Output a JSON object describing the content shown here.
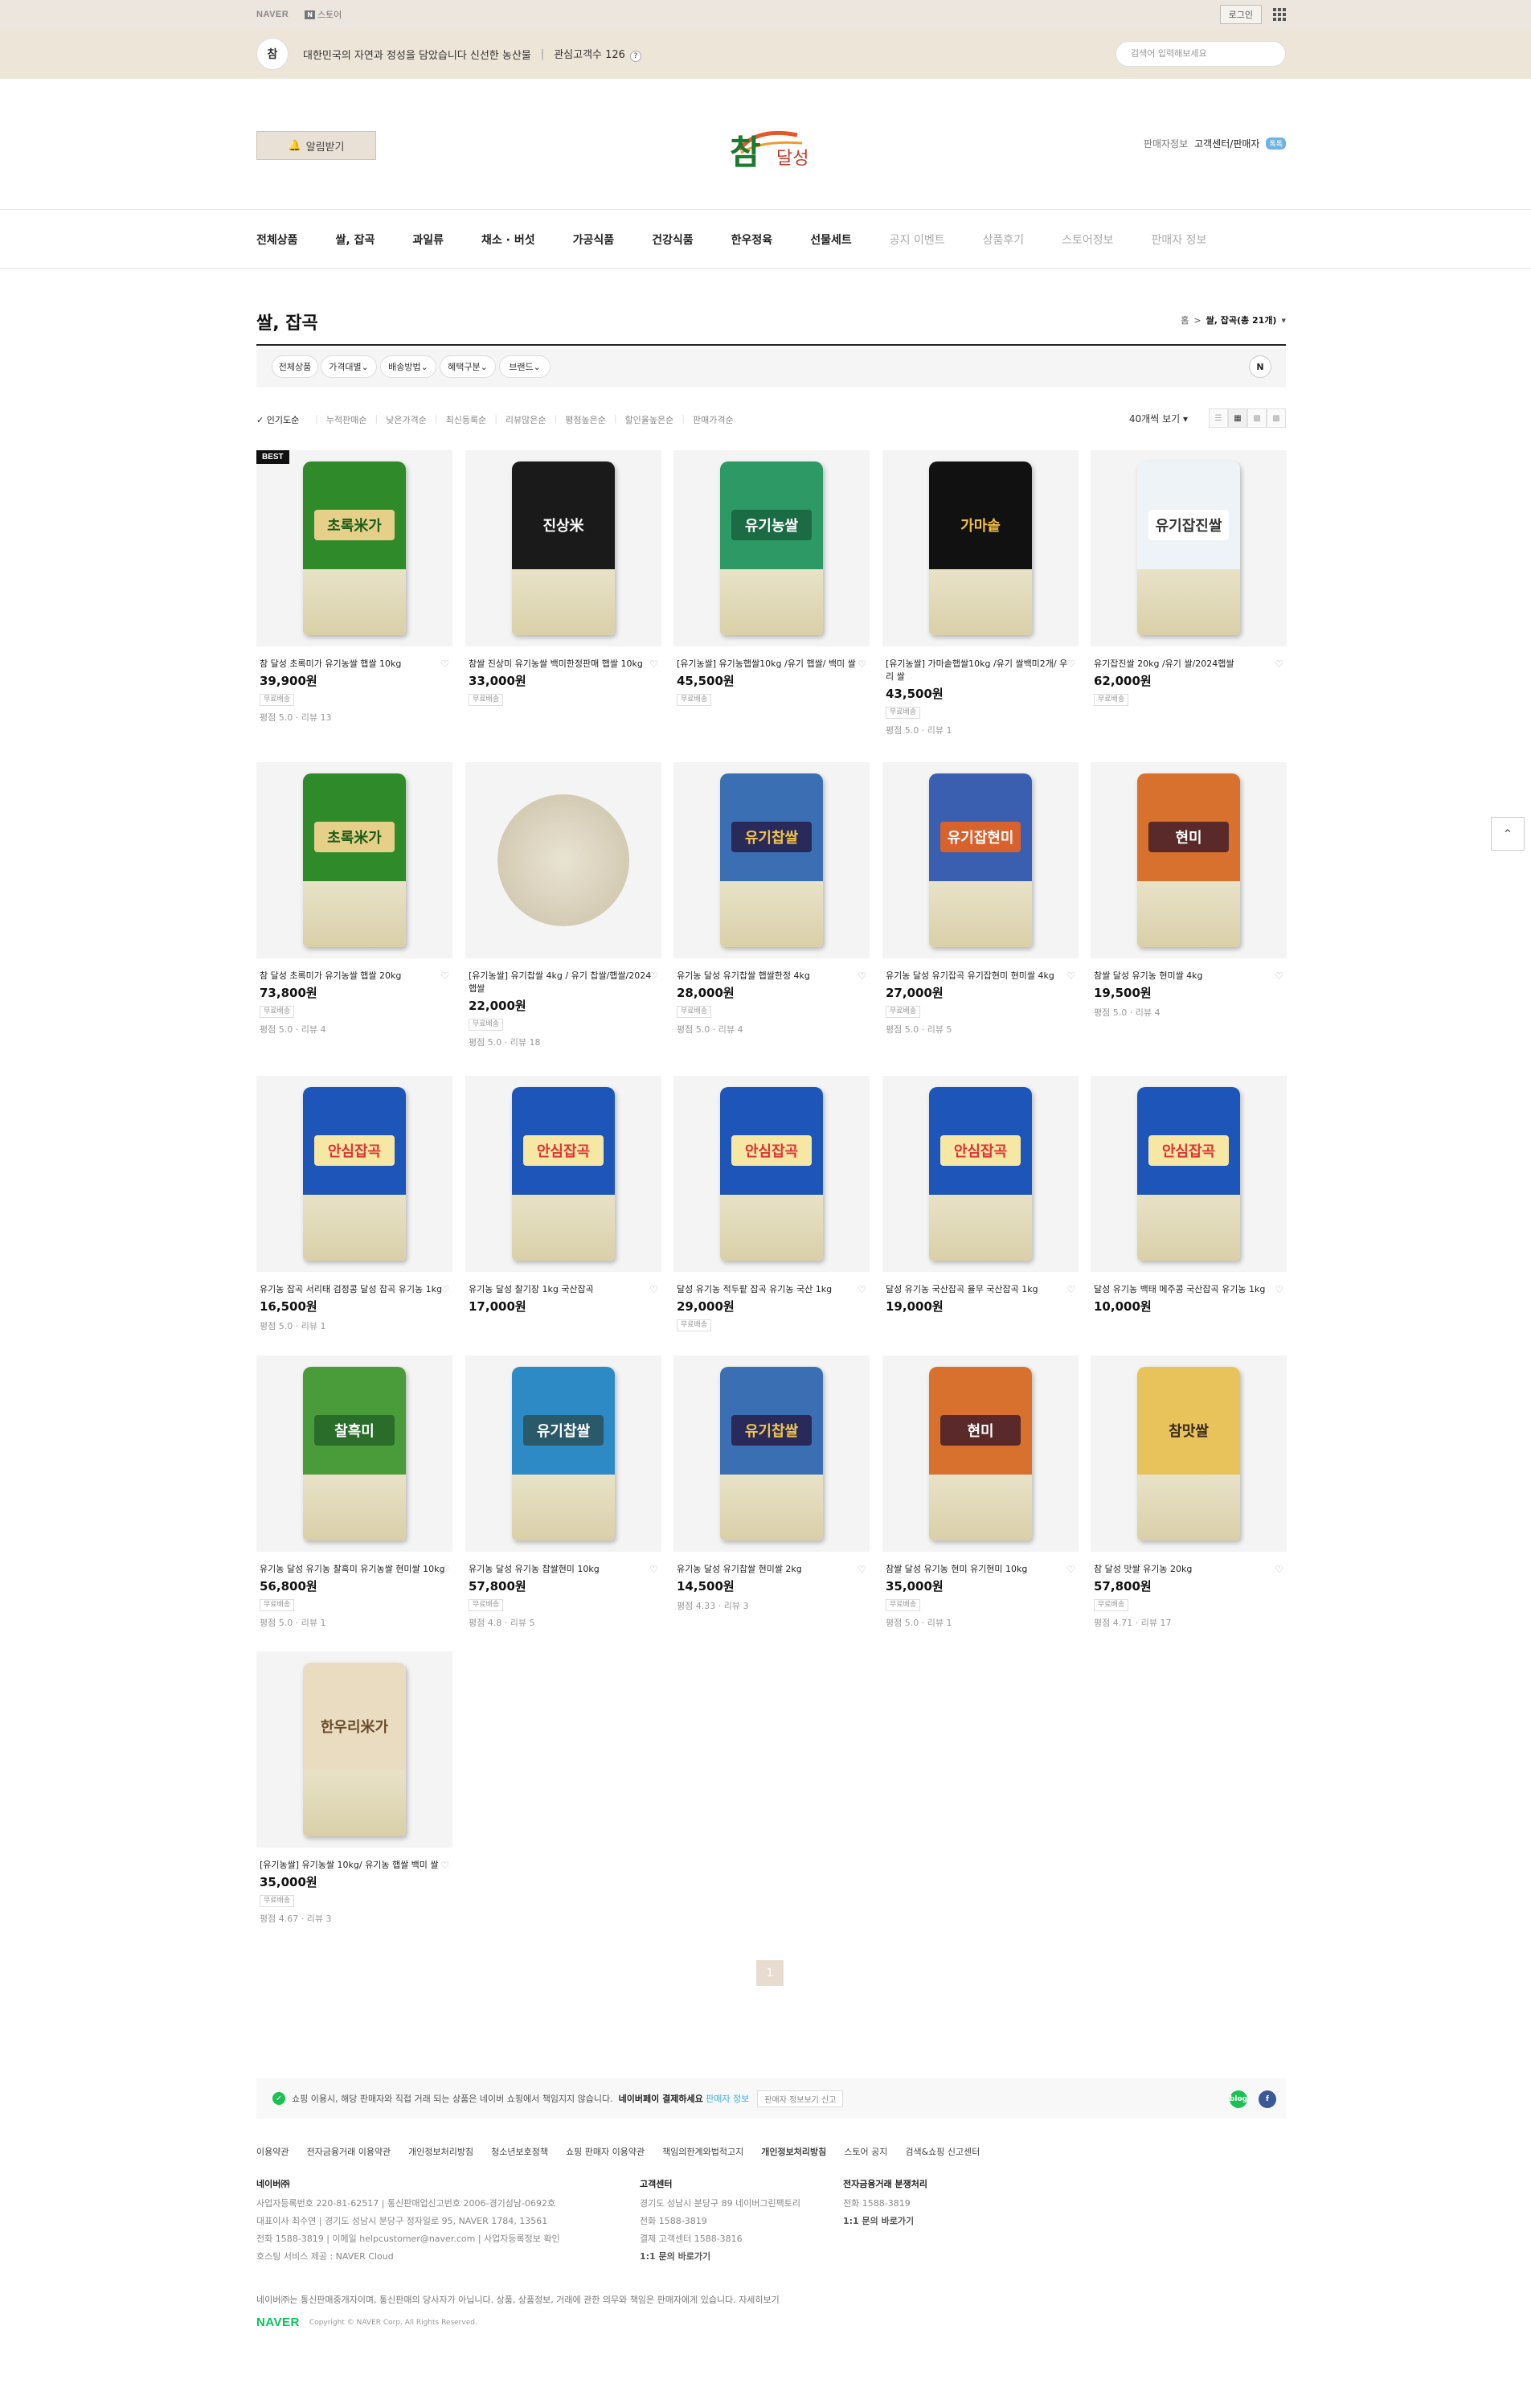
{
  "topbar": {
    "naver": "NAVER",
    "store_badge": "N",
    "store_label": "스토어",
    "login": "로그인"
  },
  "shop": {
    "logo_text": "참",
    "description": "대한민국의 자연과 정성을 담았습니다 신선한 농산물",
    "favorites": "관심고객수 126",
    "search_placeholder": "검색어 입력해보세요"
  },
  "header": {
    "notify_label": "알림받기",
    "logo_main": "참",
    "logo_sub": "달성",
    "right_label": "판매자정보",
    "right_link": "고객센터/판매자",
    "talk": "톡톡"
  },
  "nav": {
    "items": [
      {
        "label": "전체상품",
        "dim": false
      },
      {
        "label": "쌀, 잡곡",
        "dim": false
      },
      {
        "label": "과일류",
        "dim": false
      },
      {
        "label": "채소 · 버섯",
        "dim": false
      },
      {
        "label": "가공식품",
        "dim": false
      },
      {
        "label": "건강식품",
        "dim": false
      },
      {
        "label": "한우정육",
        "dim": false
      },
      {
        "label": "선물세트",
        "dim": false
      },
      {
        "label": "공지 이벤트",
        "dim": true
      },
      {
        "label": "상품후기",
        "dim": true
      },
      {
        "label": "스토어정보",
        "dim": true
      },
      {
        "label": "판매자 정보",
        "dim": true
      }
    ]
  },
  "page": {
    "title": "쌀, 잡곡",
    "crumb_home": "홈",
    "crumb_current": "쌀, 잡곡",
    "count": "21"
  },
  "filters": [
    "전체상품",
    "가격대별",
    "배송방법",
    "혜택구분",
    "브랜드"
  ],
  "filter_reset": "N",
  "sorts": [
    "인기도순",
    "누적판매순",
    "낮은가격순",
    "최신등록순",
    "리뷰많은순",
    "평점높은순",
    "할인율높은순",
    "판매가격순"
  ],
  "per_page": "40개씩 보기",
  "products": [
    {
      "name": "참 달성 초록미가 유기농쌀 햅쌀 10kg",
      "price": "39,900원",
      "tag": "무료배송",
      "meta": "평점 5.0 · 리뷰 13",
      "best": true,
      "color": "#2f8a2a",
      "label": "초록米가",
      "labelcolor": "#1b5c18",
      "labelbg": "#e6d089"
    },
    {
      "name": "참쌀 진상미 유기농쌀 백미한정판매 햅쌀 10kg",
      "price": "33,000원",
      "tag": "무료배송",
      "meta": "",
      "best": false,
      "color": "#1a1a1a",
      "label": "진상米",
      "labelcolor": "#fff",
      "labelbg": "transparent"
    },
    {
      "name": "[유기농쌀] 유기농햅쌀10kg /유기 햅쌀/ 백미 쌀",
      "price": "45,500원",
      "tag": "무료배송",
      "meta": "",
      "best": false,
      "color": "#2d9a65",
      "label": "유기농쌀",
      "labelcolor": "#fff",
      "labelbg": "#1b6c45"
    },
    {
      "name": "[유기농쌀] 가마솥햅쌀10kg /유기 쌀백미2개/ 우리 쌀",
      "price": "43,500원",
      "tag": "무료배송",
      "meta": "평점 5.0 · 리뷰 1",
      "best": false,
      "color": "#111111",
      "label": "가마솥",
      "labelcolor": "#f0c040",
      "labelbg": "transparent"
    },
    {
      "name": "유기잡진쌀 20kg /유기 쌀/2024햅쌀",
      "price": "62,000원",
      "tag": "무료배송",
      "meta": "",
      "best": false,
      "color": "#eef3f7",
      "label": "유기잡진쌀",
      "labelcolor": "#333",
      "labelbg": "#ffffff"
    },
    {
      "name": "참 달성 초록미가 유기농쌀 햅쌀 20kg",
      "price": "73,800원",
      "tag": "무료배송",
      "meta": "평점 5.0 · 리뷰 4",
      "best": false,
      "color": "#2f8a2a",
      "label": "초록米가",
      "labelcolor": "#1b5c18",
      "labelbg": "#e6d089"
    },
    {
      "name": "[유기농쌀] 유기찹쌀 4kg / 유기 찹쌀/햅쌀/2024햅쌀",
      "price": "22,000원",
      "tag": "무료배송",
      "meta": "평점 5.0 · 리뷰 18",
      "best": false,
      "color": "plate",
      "label": "",
      "labelcolor": "",
      "labelbg": ""
    },
    {
      "name": "유기농 달성 유기찹쌀 햅쌀한정 4kg",
      "price": "28,000원",
      "tag": "무료배송",
      "meta": "평점 5.0 · 리뷰 4",
      "best": false,
      "color": "#3a6fb4",
      "label": "유기찹쌀",
      "labelcolor": "#f3c64a",
      "labelbg": "#2a2a5a"
    },
    {
      "name": "유기농 달성 유기잡곡 유기잡현미 현미쌀 4kg",
      "price": "27,000원",
      "tag": "무료배송",
      "meta": "평점 5.0 · 리뷰 5",
      "best": false,
      "color": "#3b5fb0",
      "label": "유기잡현미",
      "labelcolor": "#fff",
      "labelbg": "#d9612b"
    },
    {
      "name": "참쌀 달성 유기농 현미쌀 4kg",
      "price": "19,500원",
      "tag": "",
      "meta": "평점 5.0 · 리뷰 4",
      "best": false,
      "color": "#d8702e",
      "label": "현미",
      "labelcolor": "#fff",
      "labelbg": "#5a2a2a"
    },
    {
      "name": "유기농 잡곡 서리태 검정콩 달성 잡곡 유기농 1kg",
      "price": "16,500원",
      "tag": "",
      "meta": "평점 5.0 · 리뷰 1",
      "best": false,
      "color": "#1d56b8",
      "label": "안심잡곡",
      "labelcolor": "#d33",
      "labelbg": "#f7e7a4"
    },
    {
      "name": "유기농 달성 찰기장 1kg 국산잡곡",
      "price": "17,000원",
      "tag": "",
      "meta": "",
      "best": false,
      "color": "#1d56b8",
      "label": "안심잡곡",
      "labelcolor": "#d33",
      "labelbg": "#f7e7a4"
    },
    {
      "name": "달성 유기농 적두팥 잡곡 유기농 국산 1kg",
      "price": "29,000원",
      "tag": "무료배송",
      "meta": "",
      "best": false,
      "color": "#1d56b8",
      "label": "안심잡곡",
      "labelcolor": "#d33",
      "labelbg": "#f7e7a4"
    },
    {
      "name": "달성 유기농 국산잡곡 율무 국산잡곡 1kg",
      "price": "19,000원",
      "tag": "",
      "meta": "",
      "best": false,
      "color": "#1d56b8",
      "label": "안심잡곡",
      "labelcolor": "#d33",
      "labelbg": "#f7e7a4"
    },
    {
      "name": "달성 유기농 백태 메주콩 국산잡곡 유기농 1kg",
      "price": "10,000원",
      "tag": "",
      "meta": "",
      "best": false,
      "color": "#1d56b8",
      "label": "안심잡곡",
      "labelcolor": "#d33",
      "labelbg": "#f7e7a4"
    },
    {
      "name": "유기농 달성 유기농 찰흑미 유기농쌀 현미쌀 10kg",
      "price": "56,800원",
      "tag": "무료배송",
      "meta": "평점 5.0 · 리뷰 1",
      "best": false,
      "color": "#4a9c3a",
      "label": "찰흑미",
      "labelcolor": "#fff",
      "labelbg": "#2a6c2a"
    },
    {
      "name": "유기농 달성 유기농 찹쌀현미 10kg",
      "price": "57,800원",
      "tag": "무료배송",
      "meta": "평점 4.8 · 리뷰 5",
      "best": false,
      "color": "#2e8ac4",
      "label": "유기찹쌀",
      "labelcolor": "#fff",
      "labelbg": "#2a5a6a"
    },
    {
      "name": "유기농 달성 유기찹쌀 현미쌀 2kg",
      "price": "14,500원",
      "tag": "",
      "meta": "평점 4.33 · 리뷰 3",
      "best": false,
      "color": "#3a6fb4",
      "label": "유기찹쌀",
      "labelcolor": "#f3c64a",
      "labelbg": "#2a2a5a"
    },
    {
      "name": "참쌀 달성 유기농 현미 유기현미 10kg",
      "price": "35,000원",
      "tag": "무료배송",
      "meta": "평점 5.0 · 리뷰 1",
      "best": false,
      "color": "#d8702e",
      "label": "현미",
      "labelcolor": "#fff",
      "labelbg": "#5a2a2a"
    },
    {
      "name": "참 달성 맛쌀 유기농 20kg",
      "price": "57,800원",
      "tag": "무료배송",
      "meta": "평점 4.71 · 리뷰 17",
      "best": false,
      "color": "#e8c25a",
      "label": "참맛쌀",
      "labelcolor": "#3a2a1a",
      "labelbg": "transparent"
    },
    {
      "name": "[유기농쌀] 유기농쌀 10kg/ 유기농 햅쌀 백미 쌀",
      "price": "35,000원",
      "tag": "무료배송",
      "meta": "평점 4.67 · 리뷰 3",
      "best": false,
      "color": "#e9dcc0",
      "label": "한우리米가",
      "labelcolor": "#6a4a2a",
      "labelbg": "transparent"
    }
  ],
  "pagination": {
    "current": "1"
  },
  "footer": {
    "notice": "쇼핑 이용시, 해당 판매자와 직접 거래 되는 상품은 네이버 쇼핑에서 책임지지 않습니다.",
    "notice_bold": "네이버페이 결제하세요",
    "notice_link": "판매자 정보",
    "notice_btn": "판매자 정보보기 신고",
    "links": [
      "이용약관",
      "전자금융거래 이용약관",
      "개인정보처리방침",
      "청소년보호정책",
      "쇼핑 판매자 이용약관",
      "책임의한계와법적고지",
      "개인정보처리방침",
      "스토어 공지",
      "검색&쇼핑 신고센터"
    ],
    "col1": {
      "title": "네이버㈜",
      "lines": [
        "사업자등록번호 220-81-62517  |  통신판매업신고번호 2006-경기성남-0692호",
        "대표이사 최수연  |  경기도 성남시 분당구 정자일로 95, NAVER 1784, 13561",
        "전화 1588-3819  |  이메일 helpcustomer@naver.com  |  사업자등록정보 확인",
        "호스팅 서비스 제공 : NAVER Cloud"
      ]
    },
    "col2": {
      "title": "고객센터",
      "lines": [
        "경기도 성남시 분당구 89 네이버그린팩토리",
        "전화 1588-3819",
        "결제 고객센터 1588-3816",
        "1:1 문의 바로가기"
      ]
    },
    "col3": {
      "title": "전자금융거래 분쟁처리",
      "lines": [
        "전화 1588-3819",
        "1:1 문의 바로가기"
      ]
    },
    "disclaimer": "네이버㈜는 통신판매중개자이며, 통신판매의 당사자가 아닙니다. 상품, 상품정보, 거래에 관한 의무와 책임은 판매자에게 있습니다. 자세히보기",
    "naver": "NAVER",
    "copyright": "Copyright © NAVER Corp. All Rights Reserved."
  }
}
